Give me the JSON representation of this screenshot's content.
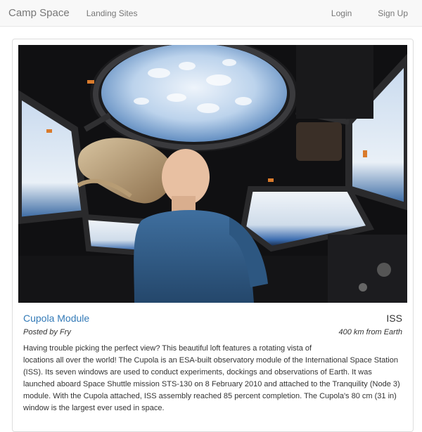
{
  "navbar": {
    "brand": "Camp Space",
    "links": {
      "landing_sites": "Landing Sites",
      "login": "Login",
      "signup": "Sign Up"
    }
  },
  "site": {
    "image_alt": "Astronaut looking out the Cupola windows at Earth",
    "name": "Cupola Module",
    "location": "ISS",
    "posted_by": "Posted by Fry",
    "distance": "400 km from Earth",
    "description_line1": "Having trouble picking the perfect view? This beautiful loft features a rotating vista of",
    "description_rest": "locations all over the world! The Cupola is an ESA-built observatory module of the International Space Station (ISS). Its seven windows are used to conduct experiments, dockings and observations of Earth. It was launched aboard Space Shuttle mission STS-130 on 8 February 2010 and attached to the Tranquility (Node 3) module. With the Cupola attached, ISS assembly reached 85 percent completion. The Cupola's 80 cm (31 in) window is the largest ever used in space."
  },
  "colors": {
    "navbar_bg": "#f8f8f8",
    "link": "#337ab7",
    "nav_text": "#777777"
  }
}
